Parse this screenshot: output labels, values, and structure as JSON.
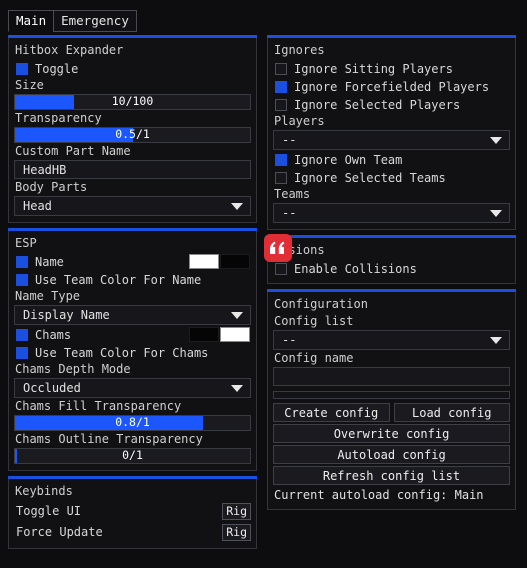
{
  "window": {
    "title": "Main"
  },
  "tabs": [
    {
      "label": "Main",
      "active": true
    },
    {
      "label": "Emergency",
      "active": false
    }
  ],
  "left_column": {
    "hitbox": {
      "title": "Hitbox Expander",
      "toggle_label": "Toggle",
      "toggle_on": true,
      "size_label": "Size",
      "size_value": "10/100",
      "size_percent": 25,
      "transparency_label": "Transparency",
      "transparency_value": "0.5/1",
      "transparency_percent": 50,
      "custom_part_label": "Custom Part Name",
      "custom_part_value": "HeadHB",
      "body_parts_label": "Body Parts",
      "body_parts_value": "Head"
    },
    "esp": {
      "title": "ESP",
      "name_label": "Name",
      "name_on": true,
      "name_color_primary": "#ffffff",
      "name_color_secondary": "#050505",
      "use_team_color_name_label": "Use Team Color For Name",
      "use_team_color_name_on": true,
      "name_type_label": "Name Type",
      "name_type_value": "Display Name",
      "chams_label": "Chams",
      "chams_on": true,
      "chams_color_primary": "#050505",
      "chams_color_secondary": "#ffffff",
      "use_team_color_chams_label": "Use Team Color For Chams",
      "use_team_color_chams_on": true,
      "chams_depth_label": "Chams Depth Mode",
      "chams_depth_value": "Occluded",
      "fill_transparency_label": "Chams Fill Transparency",
      "fill_transparency_value": "0.8/1",
      "fill_transparency_percent": 80,
      "outline_transparency_label": "Chams Outline Transparency",
      "outline_transparency_value": "0/1",
      "outline_transparency_percent": 1
    },
    "keybinds": {
      "title": "Keybinds",
      "items": [
        {
          "name": "Toggle UI",
          "key": "Rig"
        },
        {
          "name": "Force Update",
          "key": "Rig"
        }
      ]
    }
  },
  "right_column": {
    "ignores": {
      "title": "Ignores",
      "sitting_label": "Ignore Sitting Players",
      "sitting_on": false,
      "forcefielded_label": "Ignore Forcefielded Players",
      "forcefielded_on": true,
      "selected_players_label": "Ignore Selected Players",
      "selected_players_on": false,
      "players_label": "Players",
      "players_value": "--",
      "own_team_label": "Ignore Own Team",
      "own_team_on": true,
      "selected_teams_label": "Ignore Selected Teams",
      "selected_teams_on": false,
      "teams_label": "Teams",
      "teams_value": "--"
    },
    "collisions": {
      "title": "lisions",
      "enable_label": "Enable Collisions",
      "enable_on": false,
      "badge_icon": "quote-icon",
      "badge_color": "#e12d36"
    },
    "configuration": {
      "title": "Configuration",
      "config_list_label": "Config list",
      "config_list_value": "--",
      "config_name_label": "Config name",
      "config_name_value": "",
      "create_label": "Create config",
      "load_label": "Load config",
      "overwrite_label": "Overwrite config",
      "autoload_label": "Autoload config",
      "refresh_label": "Refresh config list",
      "current_autoload": "Current autoload config: Main"
    }
  },
  "colors": {
    "accent": "#1b4fe0",
    "slider_fill": "#1b56ff",
    "panel_bg": "#111114",
    "window_bg": "#0d0d10",
    "border": "#34343a",
    "badge_red": "#e12d36"
  }
}
